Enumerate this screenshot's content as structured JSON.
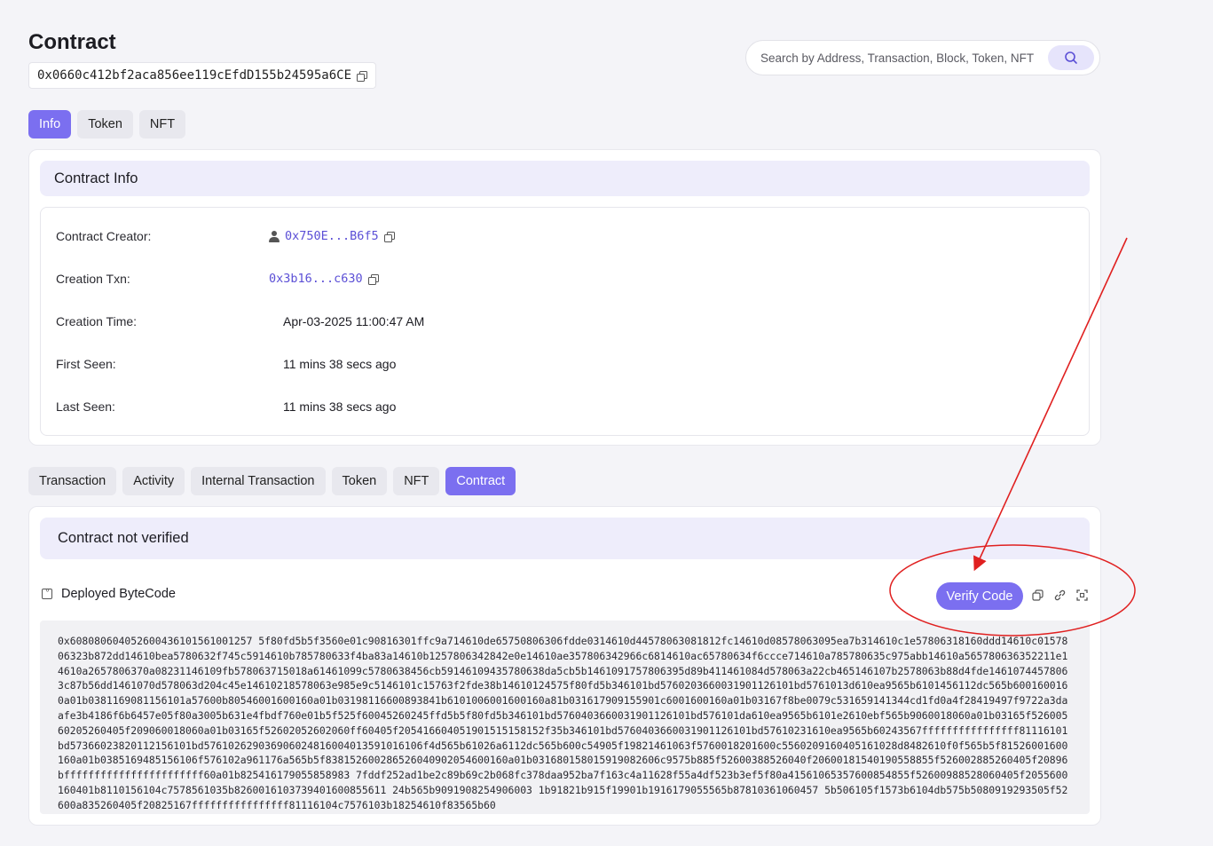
{
  "header": {
    "title": "Contract",
    "address": "0x0660c412bf2aca856ee119cEfdD155b24595a6CE"
  },
  "search": {
    "placeholder": "Search by Address, Transaction, Block, Token, NFT"
  },
  "top_tabs": [
    {
      "label": "Info",
      "active": true
    },
    {
      "label": "Token",
      "active": false
    },
    {
      "label": "NFT",
      "active": false
    }
  ],
  "contract_info": {
    "heading": "Contract Info",
    "rows": [
      {
        "label": "Contract Creator:",
        "value": "0x750E...B6f5"
      },
      {
        "label": "Creation Txn:",
        "value": "0x3b16...c630"
      },
      {
        "label": "Creation Time:",
        "value": "Apr-03-2025 11:00:47 AM"
      },
      {
        "label": "First Seen:",
        "value": "11 mins 38 secs ago"
      },
      {
        "label": "Last Seen:",
        "value": "11 mins 38 secs ago"
      }
    ]
  },
  "bottom_tabs": [
    {
      "label": "Transaction",
      "active": false
    },
    {
      "label": "Activity",
      "active": false
    },
    {
      "label": "Internal Transaction",
      "active": false
    },
    {
      "label": "Token",
      "active": false
    },
    {
      "label": "NFT",
      "active": false
    },
    {
      "label": "Contract",
      "active": true
    }
  ],
  "contract": {
    "status": "Contract not verified",
    "bytecode_label": "Deployed ByteCode",
    "verify_label": "Verify Code",
    "bytecode": "0x608080604052600436101561001257 5f80fd5b5f3560e01c90816301ffc9a714610de65750806306fdde0314610d44578063081812fc14610d08578063095ea7b314610c1e57806318160ddd14610c0157806323b872dd14610bea5780632f745c5914610b785780633f4ba83a14610b1257806342842e0e14610ae357806342966c6814610ac65780634f6ccce714610a785780635c975abb14610a565780636352211e14610a2657806370a08231146109fb578063715018a61461099c5780638456cb59146109435780638da5cb5b1461091757806395d89b411461084d578063a22cb465146107b2578063b88d4fde14610744578063c87b56dd1461070d578063d204c45e14610218578063e985e9c5146101c15763f2fde38b14610124575f80fd5b346101bd5760203660031901126101bd5761013d610ea9565b6101456112dc565b6001600160a01b0381169081156101a57600b80546001600160a01b03198116600893841b6101006001600160a81b031617909155901c6001600160a01b03167f8be0079c531659141344cd1fd0a4f28419497f9722a3daafe3b4186f6b6457e05f80a3005b631e4fbdf760e01b5f525f60045260245ffd5b5f80fd5b346101bd5760403660031901126101bd576101da610ea9565b6101e2610ebf565b9060018060a01b03165f52600560205260405f209060018060a01b03165f52602052602060ff60405f205416604051901515158152f35b346101bd5760403660031901126101bd57610231610ea9565b60243567ffffffffffffffff81116101bd57366023820112156101bd576102629036906024816004013591016106f4d565b61026a6112dc565b600c54905f19821461063f5760018201600c5560209160405161028d8482610f0f565b5f81526001600160a01b0385169485156106f576102a961176a565b5f838152600286526040902054600160a01b031680158015919082606c9575b885f52600388526040f20600181540190558855f526002885260405f20896bfffffffffffffffffffffff60a01b825416179055858983 7fddf252ad1be2c89b69c2b068fc378daa952ba7f163c4a11628f55a4df523b3ef5f80a41561065357600854855f52600988528060405f2055600160401b8110156104c7578561035b8260016103739401600855611 24b565b9091908254906003 1b91821b915f19901b1916179055565b87810361060457 5b506105f1573b6104db575b5080919293505f52600a835260405f20825167ffffffffffffffff81116104c7576103b18254610f83565b60"
  }
}
